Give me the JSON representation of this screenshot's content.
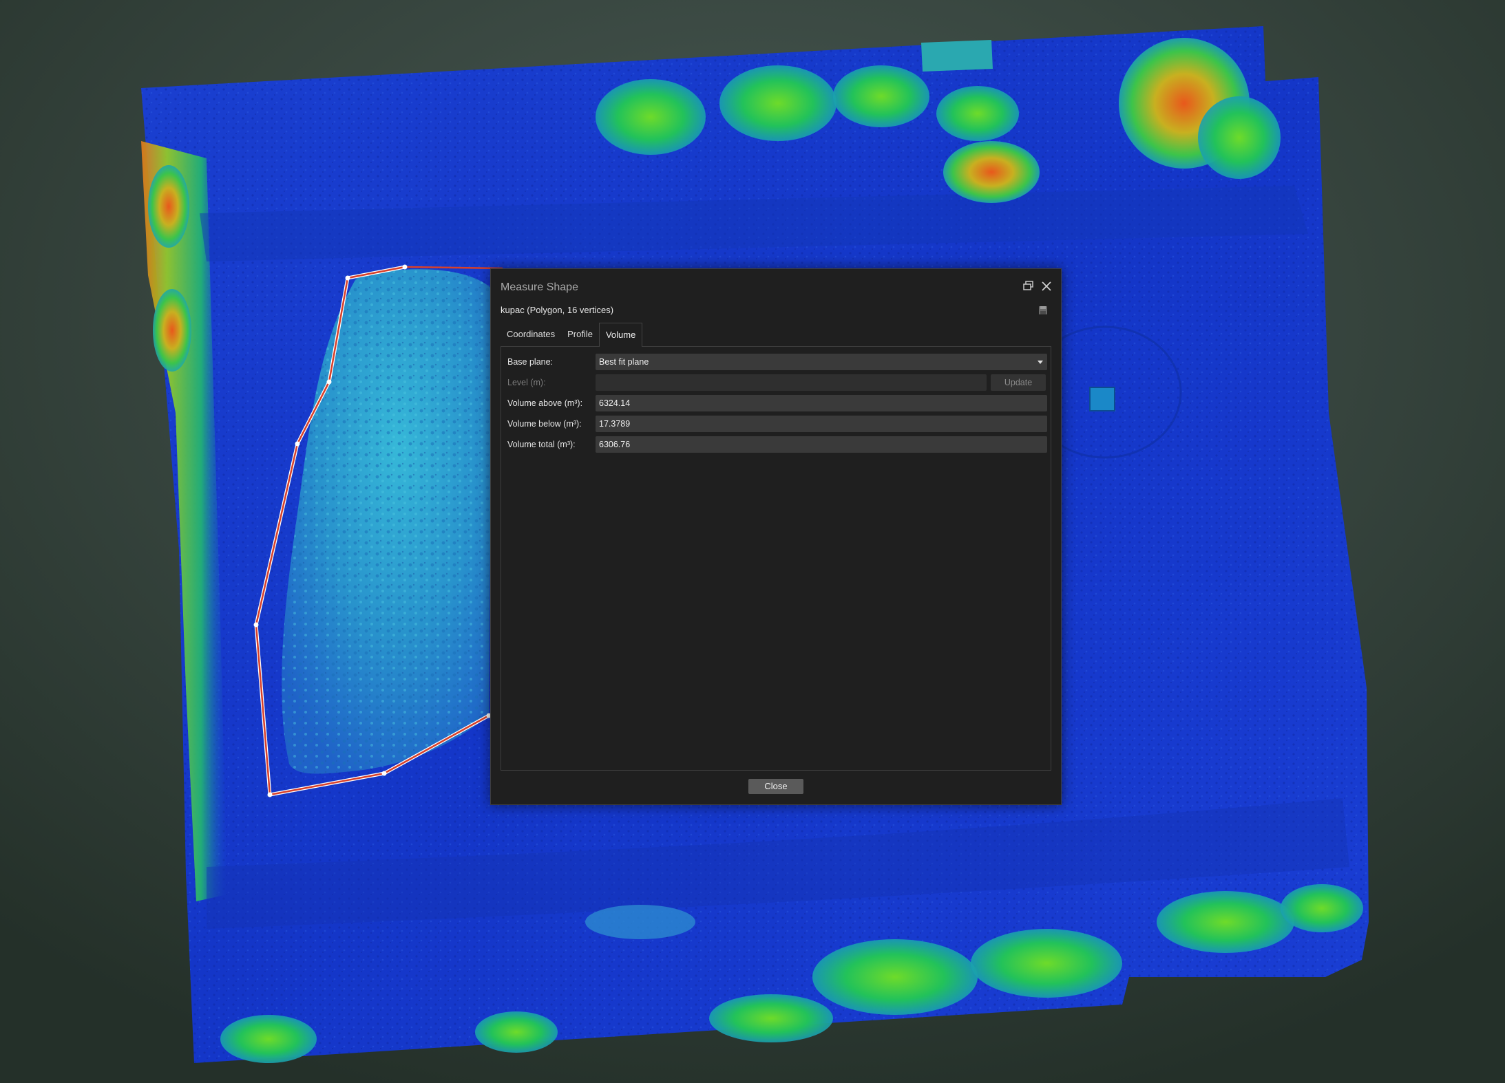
{
  "dialog": {
    "title": "Measure Shape",
    "subtitle": "kupac (Polygon, 16 vertices)",
    "tabs": [
      {
        "label": "Coordinates",
        "active": false
      },
      {
        "label": "Profile",
        "active": false
      },
      {
        "label": "Volume",
        "active": true
      }
    ],
    "fields": {
      "base_plane_label": "Base plane:",
      "base_plane_value": "Best fit plane",
      "level_label": "Level (m):",
      "level_value": "",
      "update_label": "Update",
      "volume_above_label": "Volume above (m³):",
      "volume_above_value": "6324.14",
      "volume_below_label": "Volume below (m³):",
      "volume_below_value": "17.3789",
      "volume_total_label": "Volume total (m³):",
      "volume_total_value": "6306.76"
    },
    "close_label": "Close",
    "icons": {
      "restore": "restore-window-icon",
      "close": "close-icon",
      "save": "save-icon"
    }
  },
  "map": {
    "layer": "elevation-color-relief",
    "polygon_color": "#e0503a",
    "vertex_color": "#ffffff"
  }
}
